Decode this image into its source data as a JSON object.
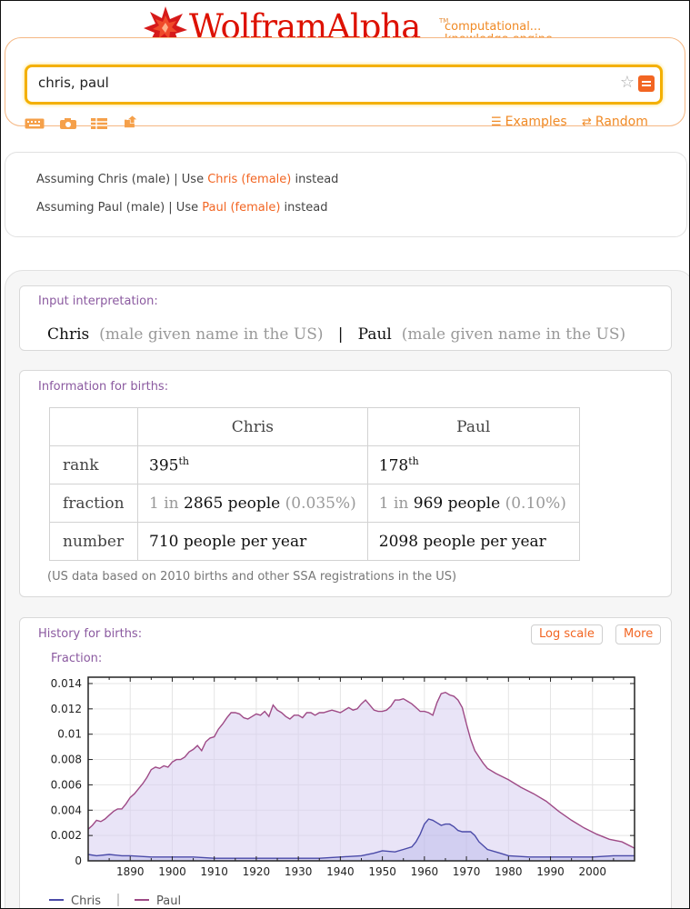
{
  "header": {
    "logo_text": "WolframAlpha",
    "logo_tm": "TM",
    "tagline_line1": "computational...",
    "tagline_line2": "knowledge engine",
    "brand_color": "#dd1100",
    "accent_color": "#f26522"
  },
  "search": {
    "query": "chris, paul",
    "favorite_icon": "star-icon",
    "submit_icon": "equal-icon"
  },
  "toolbar": {
    "icons": [
      "keyboard-icon",
      "camera-icon",
      "table-icon",
      "upload-icon"
    ],
    "examples_label": "Examples",
    "random_label": "Random"
  },
  "assumptions": [
    {
      "prefix": "Assuming Chris (male) | Use ",
      "link": "Chris (female)",
      "suffix": " instead"
    },
    {
      "prefix": "Assuming Paul (male) | Use ",
      "link": "Paul (female)",
      "suffix": " instead"
    }
  ],
  "input_pod": {
    "title": "Input interpretation:",
    "name1": "Chris",
    "desc1": "(male given name in the US)",
    "separator": "|",
    "name2": "Paul",
    "desc2": "(male given name in the US)"
  },
  "births_pod": {
    "title": "Information for births:",
    "columns": [
      "Chris",
      "Paul"
    ],
    "rank": {
      "label": "rank",
      "chris_value": "395",
      "paul_value": "178",
      "suffix": "th"
    },
    "fraction": {
      "label": "fraction",
      "one_in": "1 in",
      "chris_count": "2865 people",
      "chris_pct": "(0.035%)",
      "paul_count": "969 people",
      "paul_pct": "(0.10%)"
    },
    "number": {
      "label": "number",
      "chris_value": "710 people per year",
      "paul_value": "2098 people per year"
    },
    "footnote": "(US data based on 2010 births and other SSA registrations in the US)"
  },
  "history_pod": {
    "title": "History for births:",
    "log_scale_label": "Log scale",
    "more_label": "More",
    "fraction_label": "Fraction:"
  },
  "chart_data": {
    "type": "area",
    "title": "",
    "xlabel": "",
    "ylabel": "Fraction:",
    "xlim": [
      1880,
      2010
    ],
    "ylim": [
      0,
      0.0145
    ],
    "x_ticks": [
      1890,
      1900,
      1910,
      1920,
      1930,
      1940,
      1950,
      1960,
      1970,
      1980,
      1990,
      2000
    ],
    "y_ticks": [
      0,
      0.002,
      0.004,
      0.006,
      0.008,
      0.01,
      0.012,
      0.014
    ],
    "y_tick_labels": [
      "0",
      "0.002",
      "0.004",
      "0.006",
      "0.008",
      "0.01",
      "0.012",
      "0.014"
    ],
    "grid": true,
    "legend_position": "bottom-left",
    "series": [
      {
        "name": "Chris",
        "color": "#4a4aa8",
        "x": [
          1880,
          1882,
          1885,
          1888,
          1890,
          1895,
          1900,
          1905,
          1910,
          1915,
          1920,
          1925,
          1930,
          1935,
          1940,
          1945,
          1948,
          1950,
          1953,
          1955,
          1957,
          1958,
          1959,
          1960,
          1961,
          1962,
          1963,
          1964,
          1965,
          1966,
          1967,
          1968,
          1969,
          1970,
          1971,
          1972,
          1973,
          1975,
          1978,
          1980,
          1985,
          1990,
          1995,
          2000,
          2005,
          2010
        ],
        "values": [
          0.0005,
          0.0004,
          0.0005,
          0.0004,
          0.0004,
          0.0003,
          0.0003,
          0.0003,
          0.0002,
          0.0002,
          0.0002,
          0.0002,
          0.0002,
          0.0002,
          0.0003,
          0.0004,
          0.0006,
          0.0008,
          0.0007,
          0.0009,
          0.0011,
          0.0015,
          0.0021,
          0.0029,
          0.0033,
          0.0032,
          0.003,
          0.0028,
          0.0029,
          0.0029,
          0.0027,
          0.0024,
          0.0023,
          0.0023,
          0.0023,
          0.002,
          0.0015,
          0.0009,
          0.0006,
          0.0004,
          0.0003,
          0.0003,
          0.0003,
          0.0003,
          0.0004,
          0.0004
        ]
      },
      {
        "name": "Paul",
        "color": "#9e4a86",
        "x": [
          1880,
          1881,
          1882,
          1883,
          1884,
          1885,
          1886,
          1887,
          1888,
          1889,
          1890,
          1891,
          1892,
          1893,
          1894,
          1895,
          1896,
          1897,
          1898,
          1899,
          1900,
          1901,
          1902,
          1903,
          1904,
          1905,
          1906,
          1907,
          1908,
          1909,
          1910,
          1911,
          1912,
          1913,
          1914,
          1915,
          1916,
          1917,
          1918,
          1919,
          1920,
          1921,
          1922,
          1923,
          1924,
          1925,
          1926,
          1927,
          1928,
          1929,
          1930,
          1931,
          1932,
          1933,
          1934,
          1935,
          1936,
          1937,
          1938,
          1939,
          1940,
          1941,
          1942,
          1943,
          1944,
          1945,
          1946,
          1947,
          1948,
          1949,
          1950,
          1951,
          1952,
          1953,
          1954,
          1955,
          1956,
          1957,
          1958,
          1959,
          1960,
          1961,
          1962,
          1963,
          1964,
          1965,
          1966,
          1967,
          1968,
          1969,
          1970,
          1971,
          1972,
          1973,
          1974,
          1975,
          1977,
          1980,
          1983,
          1986,
          1989,
          1992,
          1995,
          1998,
          2001,
          2004,
          2007,
          2010
        ],
        "values": [
          0.0025,
          0.0028,
          0.0032,
          0.0031,
          0.0033,
          0.0036,
          0.0039,
          0.0041,
          0.0041,
          0.0045,
          0.005,
          0.0053,
          0.0057,
          0.0061,
          0.0066,
          0.0072,
          0.0074,
          0.0073,
          0.0075,
          0.0074,
          0.0078,
          0.008,
          0.008,
          0.0082,
          0.0086,
          0.0088,
          0.0091,
          0.0087,
          0.0094,
          0.0097,
          0.0098,
          0.0104,
          0.0108,
          0.0113,
          0.0117,
          0.0117,
          0.0116,
          0.0113,
          0.0112,
          0.0114,
          0.0116,
          0.0115,
          0.0118,
          0.0114,
          0.0123,
          0.0119,
          0.0117,
          0.0114,
          0.0112,
          0.0115,
          0.0115,
          0.0113,
          0.0117,
          0.0117,
          0.0115,
          0.0117,
          0.0117,
          0.0118,
          0.0119,
          0.0118,
          0.0117,
          0.0119,
          0.0121,
          0.0119,
          0.012,
          0.0124,
          0.0127,
          0.0123,
          0.0119,
          0.0118,
          0.0118,
          0.0119,
          0.0122,
          0.0127,
          0.0127,
          0.0128,
          0.0126,
          0.0124,
          0.0121,
          0.0118,
          0.0118,
          0.0117,
          0.0115,
          0.0125,
          0.0132,
          0.0133,
          0.0131,
          0.013,
          0.0127,
          0.0121,
          0.0108,
          0.0096,
          0.0087,
          0.0082,
          0.0077,
          0.0073,
          0.0069,
          0.0064,
          0.0058,
          0.0053,
          0.0047,
          0.0039,
          0.0032,
          0.0026,
          0.0021,
          0.0017,
          0.0015,
          0.001
        ]
      }
    ]
  }
}
